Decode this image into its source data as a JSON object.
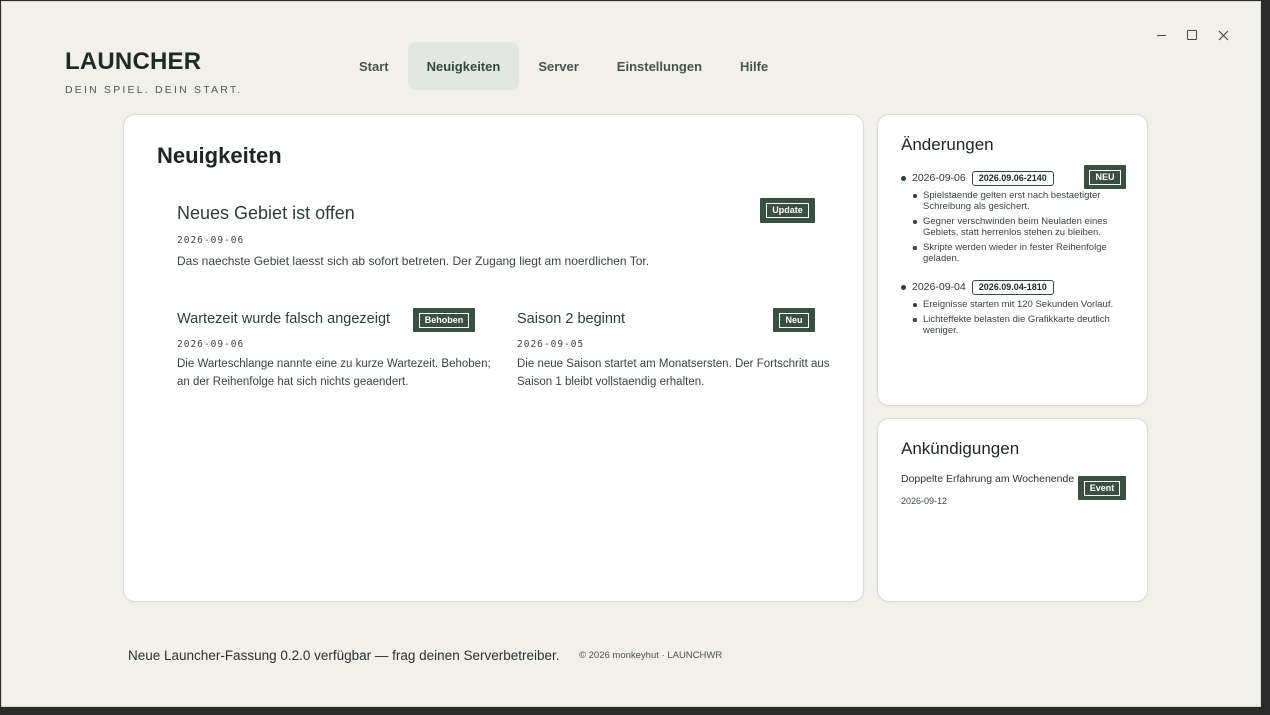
{
  "window": {
    "controls": {
      "minimize": "minimize-icon",
      "maximize": "maximize-icon",
      "close": "close-icon"
    }
  },
  "brand": {
    "title": "LAUNCHER",
    "subtitle": "DEIN SPIEL. DEIN START."
  },
  "nav": {
    "tabs": [
      {
        "label": "Start",
        "active": false
      },
      {
        "label": "Neuigkeiten",
        "active": true
      },
      {
        "label": "Server",
        "active": false
      },
      {
        "label": "Einstellungen",
        "active": false
      },
      {
        "label": "Hilfe",
        "active": false
      }
    ]
  },
  "news": {
    "heading": "Neuigkeiten",
    "featured": {
      "title": "Neues Gebiet ist offen",
      "tag": "Update",
      "date": "2026-09-06",
      "text": "Das naechste Gebiet laesst sich ab sofort betreten. Der Zugang liegt am noerdlichen Tor."
    },
    "items": [
      {
        "title": "Wartezeit wurde falsch angezeigt",
        "tag": "Behoben",
        "date": "2026-09-06",
        "text_line1": "Die Warteschlange nannte eine zu kurze Wartezeit. Behoben;",
        "text_line2": "an der Reihenfolge hat sich nichts geaendert."
      },
      {
        "title": "Saison 2 beginnt",
        "tag": "Neu",
        "date": "2026-09-05",
        "text_line1": "Die neue Saison startet am Monatsersten. Der Fortschritt aus",
        "text_line2": "Saison 1 bleibt vollstaendig erhalten."
      }
    ]
  },
  "changes": {
    "heading": "Änderungen",
    "new_tag": "NEU",
    "entries": [
      {
        "date": "2026-09-06",
        "version": "2026.09.06-2140",
        "notes": [
          "Spielstaende gelten erst nach bestaetigter Schreibung als gesichert.",
          "Gegner verschwinden beim Neuladen eines Gebiets, statt herrenlos stehen zu bleiben.",
          "Skripte werden wieder in fester Reihenfolge geladen."
        ]
      },
      {
        "date": "2026-09-04",
        "version": "2026.09.04-1810",
        "notes": [
          "Ereignisse starten mit 120 Sekunden Vorlauf.",
          "Lichteffekte belasten die Grafikkarte deutlich weniger."
        ]
      }
    ]
  },
  "announcements": {
    "heading": "Ankündigungen",
    "items": [
      {
        "title": "Doppelte Erfahrung am Wochenende",
        "date": "2026-09-12",
        "tag": "Event"
      }
    ]
  },
  "footer": {
    "message": "Neue Launcher-Fassung 0.2.0 verfügbar — frag deinen Serverbetreiber.",
    "copyright": "© 2026 monkeyhut · LAUNCHWR"
  },
  "colors": {
    "background": "#f1f0eb",
    "accent": "#38503f",
    "active_tab": "#e2e8e1",
    "card": "#ffffff"
  }
}
